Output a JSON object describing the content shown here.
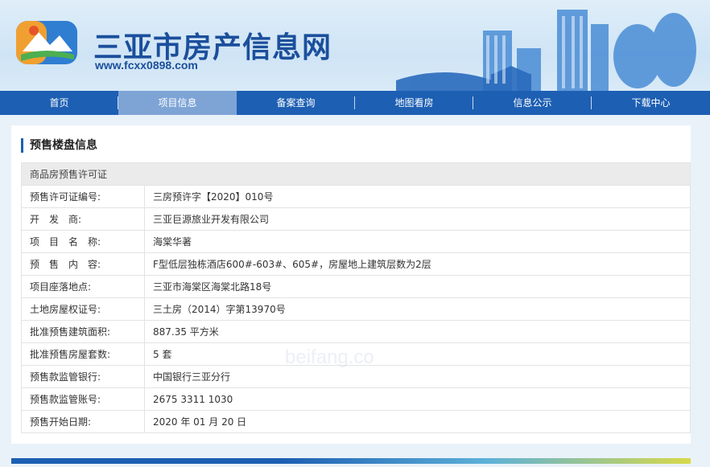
{
  "header": {
    "site_title": "三亚市房产信息网",
    "site_url": "www.fcxx0898.com"
  },
  "nav": [
    {
      "label": "首页",
      "active": false
    },
    {
      "label": "项目信息",
      "active": true
    },
    {
      "label": "备案查询",
      "active": false
    },
    {
      "label": "地图看房",
      "active": false
    },
    {
      "label": "信息公示",
      "active": false
    },
    {
      "label": "下载中心",
      "active": false
    }
  ],
  "section_title": "预售楼盘信息",
  "table": {
    "heading": "商品房预售许可证",
    "rows": [
      {
        "label": "预售许可证编号:",
        "value": "三房预许字【2020】010号"
      },
      {
        "label": "开　发　商:",
        "value": "三亚巨源旅业开发有限公司"
      },
      {
        "label": "项　目　名　称:",
        "value": "海棠华著"
      },
      {
        "label": "预　售　内　容:",
        "value": "F型低层独栋酒店600#-603#、605#，房屋地上建筑层数为2层"
      },
      {
        "label": "项目座落地点:",
        "value": "三亚市海棠区海棠北路18号"
      },
      {
        "label": "土地房屋权证号:",
        "value": "三土房（2014）字第13970号"
      },
      {
        "label": "批准预售建筑面积:",
        "value": "887.35 平方米"
      },
      {
        "label": "批准预售房屋套数:",
        "value": "5 套"
      },
      {
        "label": "预售款监管银行:",
        "value": "中国银行三亚分行"
      },
      {
        "label": "预售款监管账号:",
        "value": "2675 3311 1030"
      },
      {
        "label": "预售开始日期:",
        "value": "2020 年 01 月 20 日"
      }
    ]
  },
  "watermark": "beifang.co"
}
